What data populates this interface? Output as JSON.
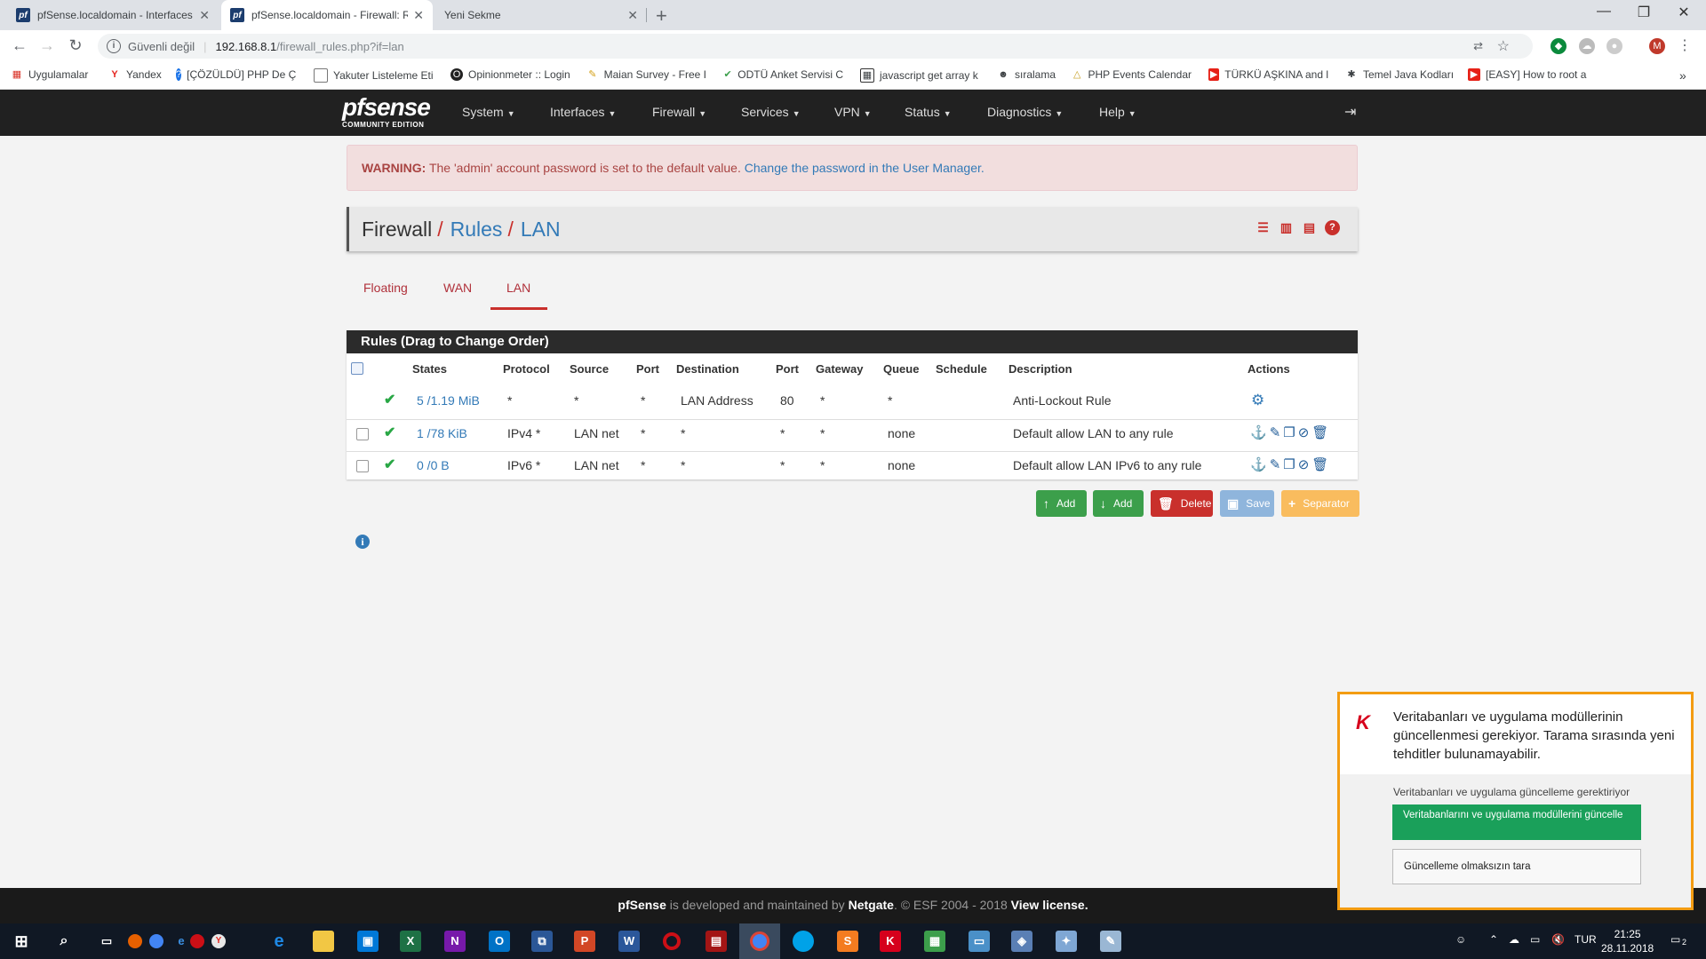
{
  "browser": {
    "tabs": [
      {
        "title": "pfSense.localdomain - Interfaces",
        "active": false
      },
      {
        "title": "pfSense.localdomain - Firewall: Rules",
        "active": true
      },
      {
        "title": "Yeni Sekme",
        "active": false
      }
    ],
    "security_label": "Güvenli değil",
    "url_host": "192.168.8.1",
    "url_path": "/firewall_rules.php?if=lan",
    "profile_initial": "M",
    "bookmarks": [
      "Uygulamalar",
      "Yandex",
      "[ÇÖZÜLDÜ] PHP De Ç",
      "Yakuter Listeleme Eti",
      "Opinionmeter :: Login",
      "Maian Survey - Free I",
      "ODTÜ Anket Servisi C",
      "javascript get array k",
      "sıralama",
      "PHP Events Calendar",
      "TÜRKÜ AŞKINA and l",
      "Temel Java Kodları",
      "[EASY] How to root a"
    ]
  },
  "nav": {
    "logo_main": "pfsense",
    "logo_sub": "COMMUNITY EDITION",
    "menus": [
      "System",
      "Interfaces",
      "Firewall",
      "Services",
      "VPN",
      "Status",
      "Diagnostics",
      "Help"
    ]
  },
  "warning": {
    "label": "WARNING:",
    "text": "The 'admin' account password is set to the default value.",
    "link": "Change the password in the User Manager."
  },
  "breadcrumb": {
    "part1": "Firewall",
    "part2": "Rules",
    "part3": "LAN"
  },
  "rule_tabs": [
    "Floating",
    "WAN",
    "LAN"
  ],
  "rules": {
    "panel_title": "Rules (Drag to Change Order)",
    "columns": [
      "States",
      "Protocol",
      "Source",
      "Port",
      "Destination",
      "Port",
      "Gateway",
      "Queue",
      "Schedule",
      "Description",
      "Actions"
    ],
    "rows": [
      {
        "states": "5 /1.19 MiB",
        "protocol": "*",
        "source": "*",
        "sport": "*",
        "destination": "LAN Address",
        "dport": "80",
        "gateway": "*",
        "queue": "*",
        "schedule": "",
        "description": "Anti-Lockout Rule"
      },
      {
        "states": "1 /78 KiB",
        "protocol": "IPv4 *",
        "source": "LAN net",
        "sport": "*",
        "destination": "*",
        "dport": "*",
        "gateway": "*",
        "queue": "none",
        "schedule": "",
        "description": "Default allow LAN to any rule"
      },
      {
        "states": "0 /0 B",
        "protocol": "IPv6 *",
        "source": "LAN net",
        "sport": "*",
        "destination": "*",
        "dport": "*",
        "gateway": "*",
        "queue": "none",
        "schedule": "",
        "description": "Default allow LAN IPv6 to any rule"
      }
    ]
  },
  "buttons": {
    "add_top": "Add",
    "add_bottom": "Add",
    "delete": "Delete",
    "save": "Save",
    "separator": "Separator"
  },
  "footer": {
    "brand": "pfSense",
    "text1": " is developed and maintained by ",
    "company": "Netgate",
    "text2": ". © ESF 2004 - 2018 ",
    "license": "View license."
  },
  "kaspersky": {
    "message": "Veritabanları ve uygulama modüllerinin güncellenmesi gerekiyor. Tarama sırasında yeni tehditler bulunamayabilir.",
    "subtext": "Veritabanları ve uygulama güncelleme gerektiriyor",
    "primary_button": "Veritabanlarını ve uygulama modüllerini güncelle",
    "secondary_button": "Güncelleme olmaksızın tara"
  },
  "taskbar": {
    "language": "TUR",
    "time": "21:25",
    "date": "28.11.2018",
    "notification_count": "2"
  },
  "colors": {
    "accent_red": "#c9302c",
    "link_blue": "#337ab7",
    "nav_dark": "#212121",
    "success_green": "#3c9f4b"
  }
}
